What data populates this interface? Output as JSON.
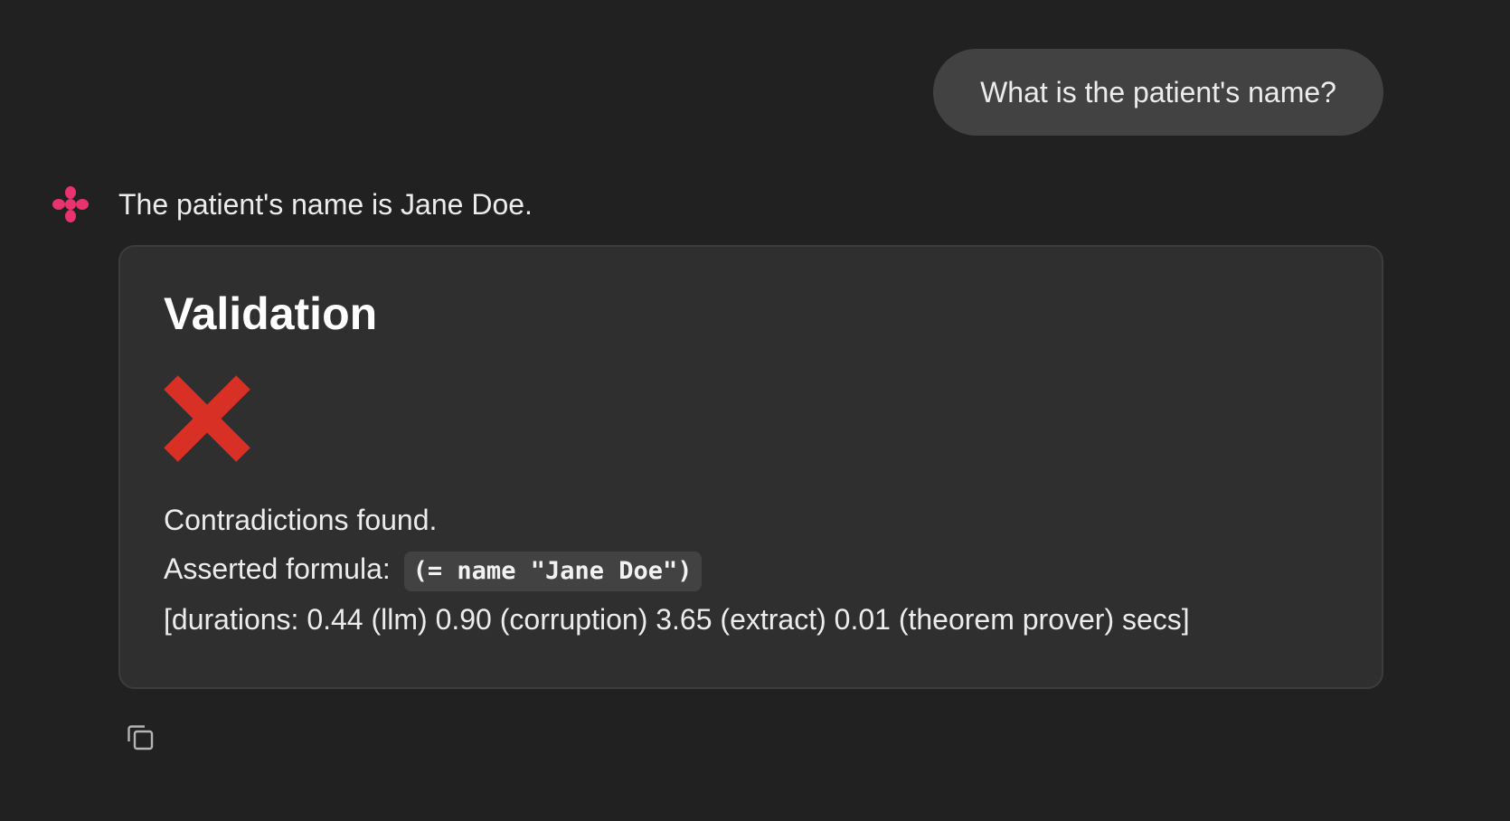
{
  "user_message": {
    "text": "What is the patient's name?"
  },
  "assistant_message": {
    "avatar_icon": "assistant-logo-icon",
    "avatar_color": "#e8336f",
    "text": "The patient's name is Jane Doe."
  },
  "validation": {
    "title": "Validation",
    "result_icon": "cross-mark-icon",
    "result_color": "#d93025",
    "status_text": "Contradictions found.",
    "formula_label": "Asserted formula:",
    "formula_code": "(= name \"Jane Doe\")",
    "durations_text": "[durations: 0.44 (llm) 0.90 (corruption) 3.65 (extract) 0.01 (theorem prover) secs]"
  },
  "actions": {
    "copy_icon": "copy-icon"
  },
  "colors": {
    "background": "#212121",
    "user_bubble": "#424242",
    "card_background": "#2f2f2f",
    "card_border": "#3c3c3c",
    "text": "#ececec"
  }
}
